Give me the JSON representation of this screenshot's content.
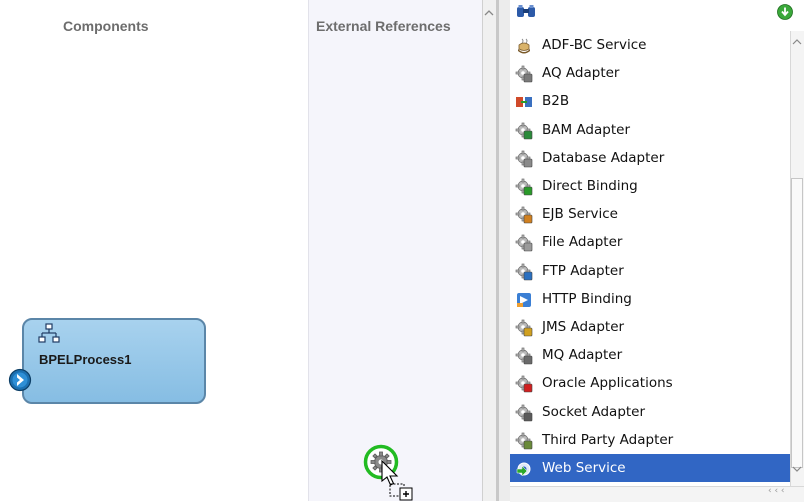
{
  "components_lane": {
    "title": "Components",
    "bpel_process": {
      "name": "BPELProcess1"
    }
  },
  "external_references_lane": {
    "title": "External References"
  },
  "component_palette": {
    "items": [
      {
        "label": "ADF-BC Service",
        "icon": "adf-bc-service-icon",
        "selected": false
      },
      {
        "label": "AQ Adapter",
        "icon": "aq-adapter-icon",
        "selected": false
      },
      {
        "label": "B2B",
        "icon": "b2b-icon",
        "selected": false
      },
      {
        "label": "BAM Adapter",
        "icon": "bam-adapter-icon",
        "selected": false
      },
      {
        "label": "Database Adapter",
        "icon": "database-adapter-icon",
        "selected": false
      },
      {
        "label": "Direct Binding",
        "icon": "direct-binding-icon",
        "selected": false
      },
      {
        "label": "EJB Service",
        "icon": "ejb-service-icon",
        "selected": false
      },
      {
        "label": "File Adapter",
        "icon": "file-adapter-icon",
        "selected": false
      },
      {
        "label": "FTP Adapter",
        "icon": "ftp-adapter-icon",
        "selected": false
      },
      {
        "label": "HTTP Binding",
        "icon": "http-binding-icon",
        "selected": false
      },
      {
        "label": "JMS Adapter",
        "icon": "jms-adapter-icon",
        "selected": false
      },
      {
        "label": "MQ Adapter",
        "icon": "mq-adapter-icon",
        "selected": false
      },
      {
        "label": "Oracle Applications",
        "icon": "oracle-applications-icon",
        "selected": false
      },
      {
        "label": "Socket Adapter",
        "icon": "socket-adapter-icon",
        "selected": false
      },
      {
        "label": "Third Party Adapter",
        "icon": "third-party-adapter-icon",
        "selected": false
      },
      {
        "label": "Web Service",
        "icon": "web-service-icon",
        "selected": true
      }
    ]
  },
  "colors": {
    "selection": "#3166c4",
    "bpel_fill": "#93c7e8",
    "drag_ring": "#22bb22"
  }
}
